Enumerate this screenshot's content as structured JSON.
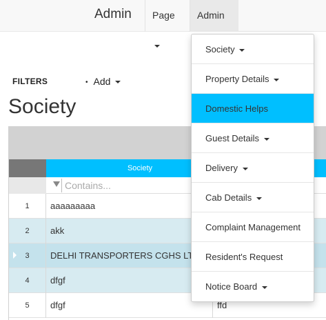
{
  "navbar": {
    "brand": "Admin",
    "page_menu": "Page",
    "admin_menu": "Admin"
  },
  "filters": {
    "label": "FILTERS",
    "add_label": "Add",
    "bullet": "•"
  },
  "page_title": "Society",
  "grid": {
    "column_header": "Society",
    "filter_placeholder": "Contains...",
    "rows": [
      {
        "num": "1",
        "society": "aaaaaaaaa",
        "col2": ""
      },
      {
        "num": "2",
        "society": "akk",
        "col2": ""
      },
      {
        "num": "3",
        "society": "DELHI TRANSPORTERS CGHS LTD",
        "col2": ""
      },
      {
        "num": "4",
        "society": "dfgf",
        "col2": ""
      },
      {
        "num": "5",
        "society": "dfgf",
        "col2": "ffd"
      }
    ]
  },
  "admin_dropdown": {
    "items": [
      {
        "label": "Society",
        "has_caret": true
      },
      {
        "label": "Property Details",
        "has_caret": true
      },
      {
        "label": "Domestic Helps",
        "has_caret": false,
        "active": true
      },
      {
        "label": "Guest Details",
        "has_caret": true
      },
      {
        "label": "Delivery",
        "has_caret": true
      },
      {
        "label": "Cab Details",
        "has_caret": true
      },
      {
        "label": "Complaint Management",
        "has_caret": false
      },
      {
        "label": "Resident's Request",
        "has_caret": false
      },
      {
        "label": "Notice Board",
        "has_caret": true
      }
    ]
  },
  "colors": {
    "accent": "#00bfff",
    "row_alt": "#d7ebf1",
    "row_selected": "#c4e2ec",
    "toolbar": "#d2d2d2"
  }
}
